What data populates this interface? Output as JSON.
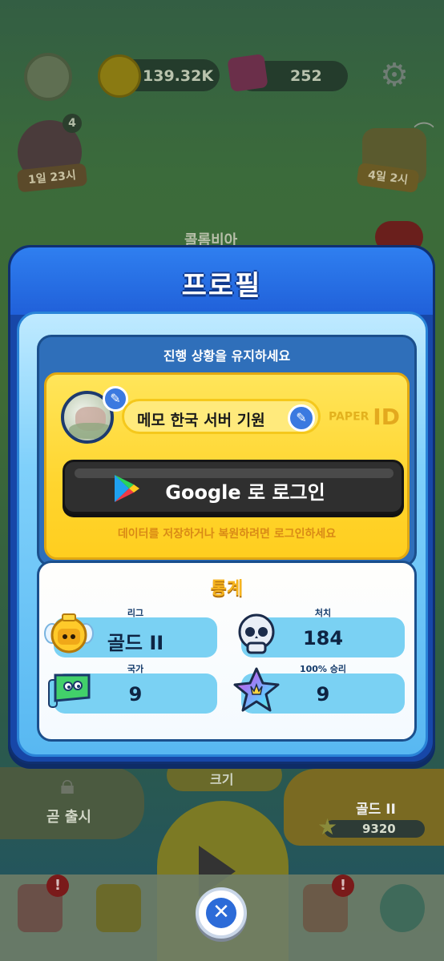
{
  "hud": {
    "gold": "139.32K",
    "gems": "252",
    "skull_count": "4",
    "skull_timer": "1일 23시",
    "chest_timer": "4일 2시",
    "behind_text": "콜롬비아"
  },
  "modal": {
    "title": "프로필",
    "progress_header": "진행 상황을 유지하세요",
    "nickname": "메모 한국 서버 기원",
    "paper_id_small": "PAPER",
    "paper_id_big": "ID",
    "google_button": "Google 로 로그인",
    "hint": "데이터를 저장하거나 복원하려면 로그인하세요",
    "stats": {
      "title": "통계",
      "items": [
        {
          "label": "리그",
          "value": "골드 II",
          "icon": "gold-league-icon"
        },
        {
          "label": "처치",
          "value": "184",
          "icon": "skull-icon"
        },
        {
          "label": "국가",
          "value": "9",
          "icon": "country-flag-icon"
        },
        {
          "label": "100% 승리",
          "value": "9",
          "icon": "rainbow-star-icon"
        }
      ]
    },
    "close_icon": "close-icon"
  },
  "background": {
    "soon_label": "곧 출시",
    "size_label": "크기",
    "league_label": "골드 II",
    "xp_value": "9320"
  },
  "colors": {
    "modal_blue": "#1747a8",
    "card_yellow": "#ffd52e",
    "stat_chip": "#7ad1f3",
    "accent_orange": "#f6b41e"
  }
}
